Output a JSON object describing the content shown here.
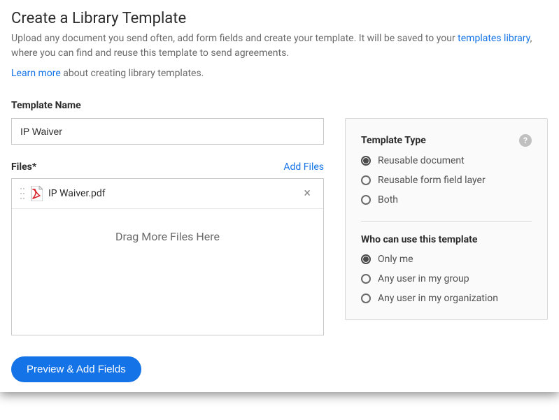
{
  "header": {
    "title": "Create a Library Template",
    "intro_before": "Upload any document you send often, add form fields and create your template. It will be saved to your ",
    "intro_link": "templates library",
    "intro_after": ", where you can find and reuse this template to send agreements.",
    "learn_more": "Learn more",
    "learn_more_after": " about creating library templates."
  },
  "form": {
    "template_name_label": "Template Name",
    "template_name_value": "IP Waiver",
    "files_label": "Files*",
    "add_files": "Add Files",
    "drag_hint": "Drag More Files Here",
    "file_item": {
      "name": "IP Waiver.pdf"
    }
  },
  "panel": {
    "type_title": "Template Type",
    "type_options": [
      {
        "label": "Reusable document",
        "selected": true
      },
      {
        "label": "Reusable form field layer",
        "selected": false
      },
      {
        "label": "Both",
        "selected": false
      }
    ],
    "perm_title": "Who can use this template",
    "perm_options": [
      {
        "label": "Only me",
        "selected": true
      },
      {
        "label": "Any user in my group",
        "selected": false
      },
      {
        "label": "Any user in my organization",
        "selected": false
      }
    ]
  },
  "buttons": {
    "preview": "Preview & Add Fields"
  }
}
